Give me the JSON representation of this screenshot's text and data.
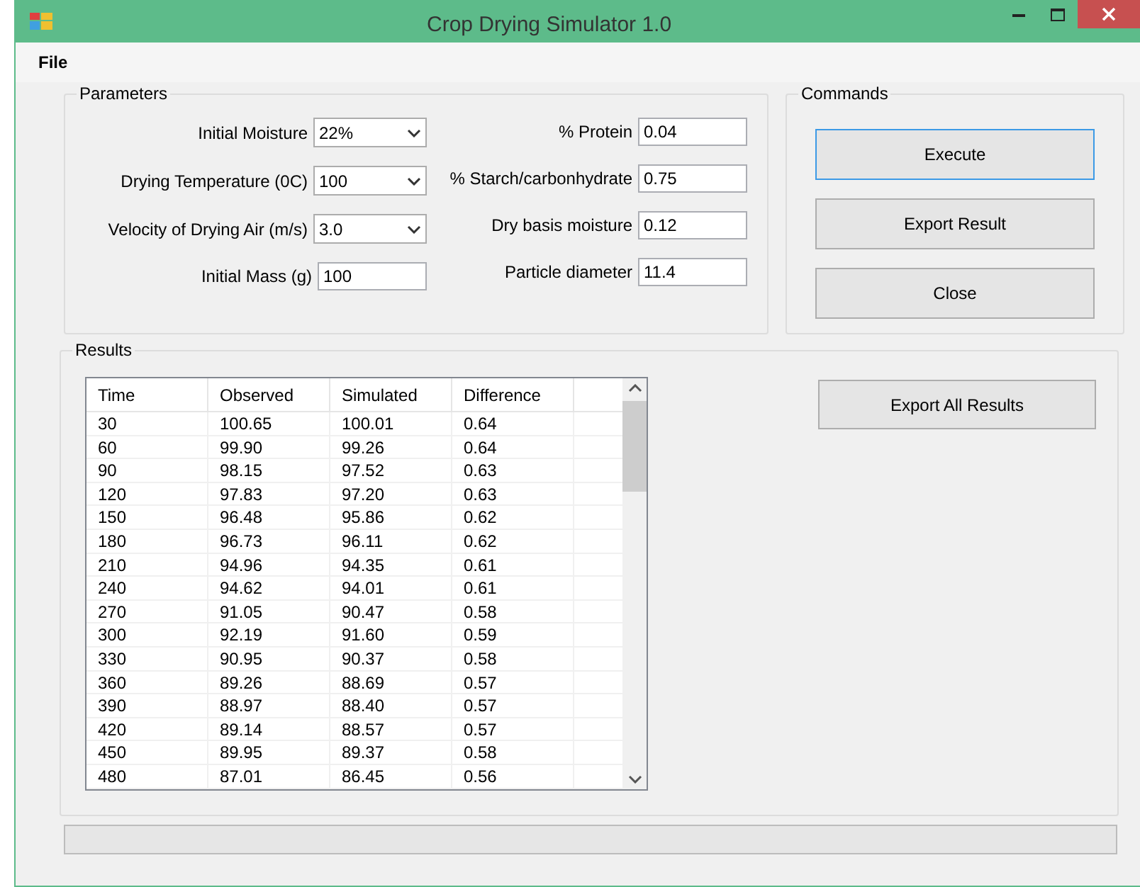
{
  "window": {
    "title": "Crop Drying Simulator 1.0"
  },
  "menu": [
    "File"
  ],
  "parameters": {
    "title": "Parameters",
    "left": [
      {
        "label": "Initial Moisture",
        "kind": "dropdown",
        "value": "22%"
      },
      {
        "label": "Drying Temperature (0C)",
        "kind": "dropdown",
        "value": "100"
      },
      {
        "label": "Velocity of Drying Air (m/s)",
        "kind": "dropdown",
        "value": "3.0"
      },
      {
        "label": "Initial Mass (g)",
        "kind": "text",
        "value": "100"
      }
    ],
    "right": [
      {
        "label": "% Protein",
        "kind": "text",
        "value": "0.04"
      },
      {
        "label": "% Starch/carbonhydrate",
        "kind": "text",
        "value": "0.75"
      },
      {
        "label": "Dry basis moisture",
        "kind": "text",
        "value": "0.12"
      },
      {
        "label": "Particle diameter",
        "kind": "text",
        "value": "11.4"
      }
    ]
  },
  "commands": {
    "title": "Commands",
    "buttons": [
      {
        "label": "Execute",
        "focused": true
      },
      {
        "label": "Export Result",
        "focused": false
      },
      {
        "label": "Close",
        "focused": false
      }
    ]
  },
  "results": {
    "title": "Results",
    "columns": [
      "Time",
      "Observed",
      "Simulated",
      "Difference"
    ],
    "rows": [
      [
        "30",
        "100.65",
        "100.01",
        "0.64"
      ],
      [
        "60",
        "99.90",
        "99.26",
        "0.64"
      ],
      [
        "90",
        "98.15",
        "97.52",
        "0.63"
      ],
      [
        "120",
        "97.83",
        "97.20",
        "0.63"
      ],
      [
        "150",
        "96.48",
        "95.86",
        "0.62"
      ],
      [
        "180",
        "96.73",
        "96.11",
        "0.62"
      ],
      [
        "210",
        "94.96",
        "94.35",
        "0.61"
      ],
      [
        "240",
        "94.62",
        "94.01",
        "0.61"
      ],
      [
        "270",
        "91.05",
        "90.47",
        "0.58"
      ],
      [
        "300",
        "92.19",
        "91.60",
        "0.59"
      ],
      [
        "330",
        "90.95",
        "90.37",
        "0.58"
      ],
      [
        "360",
        "89.26",
        "88.69",
        "0.57"
      ],
      [
        "390",
        "88.97",
        "88.40",
        "0.57"
      ],
      [
        "420",
        "89.14",
        "88.57",
        "0.57"
      ],
      [
        "450",
        "89.95",
        "89.37",
        "0.58"
      ],
      [
        "480",
        "87.01",
        "86.45",
        "0.56"
      ]
    ],
    "export_button": "Export All Results"
  }
}
